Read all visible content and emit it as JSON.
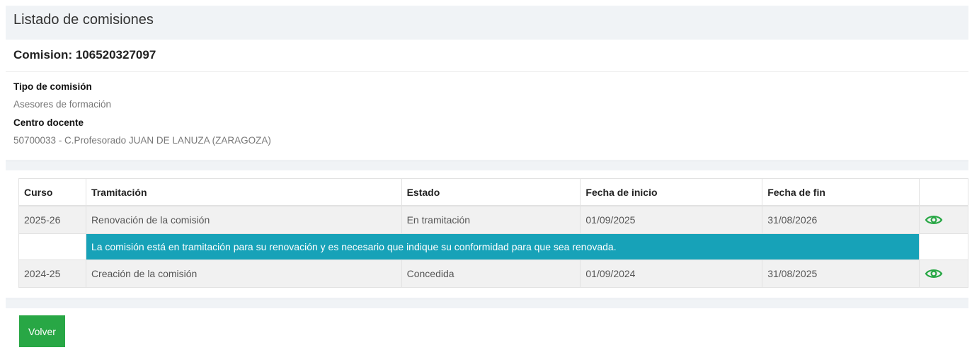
{
  "header": {
    "title": "Listado de comisiones"
  },
  "commission": {
    "title": "Comision: 106520327097",
    "fields": [
      {
        "label": "Tipo de comisión",
        "value": "Asesores de formación"
      },
      {
        "label": "Centro docente",
        "value": "50700033 - C.Profesorado JUAN DE LANUZA (ZARAGOZA)"
      }
    ]
  },
  "table": {
    "columns": [
      "Curso",
      "Tramitación",
      "Estado",
      "Fecha de inicio",
      "Fecha de fin",
      ""
    ],
    "rows": [
      {
        "curso": "2025-26",
        "tramitacion": "Renovación de la comisión",
        "estado": "En tramitación",
        "inicio": "01/09/2025",
        "fin": "31/08/2026",
        "action_icon": "eye-icon"
      },
      {
        "curso": "2024-25",
        "tramitacion": "Creación de la comisión",
        "estado": "Concedida",
        "inicio": "01/09/2024",
        "fin": "31/08/2025",
        "action_icon": "eye-icon"
      }
    ],
    "notice": "La comisión está en tramitación para su renovación y es necesario que indique su conformidad para que sea renovada."
  },
  "actions": {
    "back_label": "Volver"
  },
  "colors": {
    "notice_bg": "#17a2b8",
    "button_bg": "#28a745",
    "icon": "#28a745"
  }
}
